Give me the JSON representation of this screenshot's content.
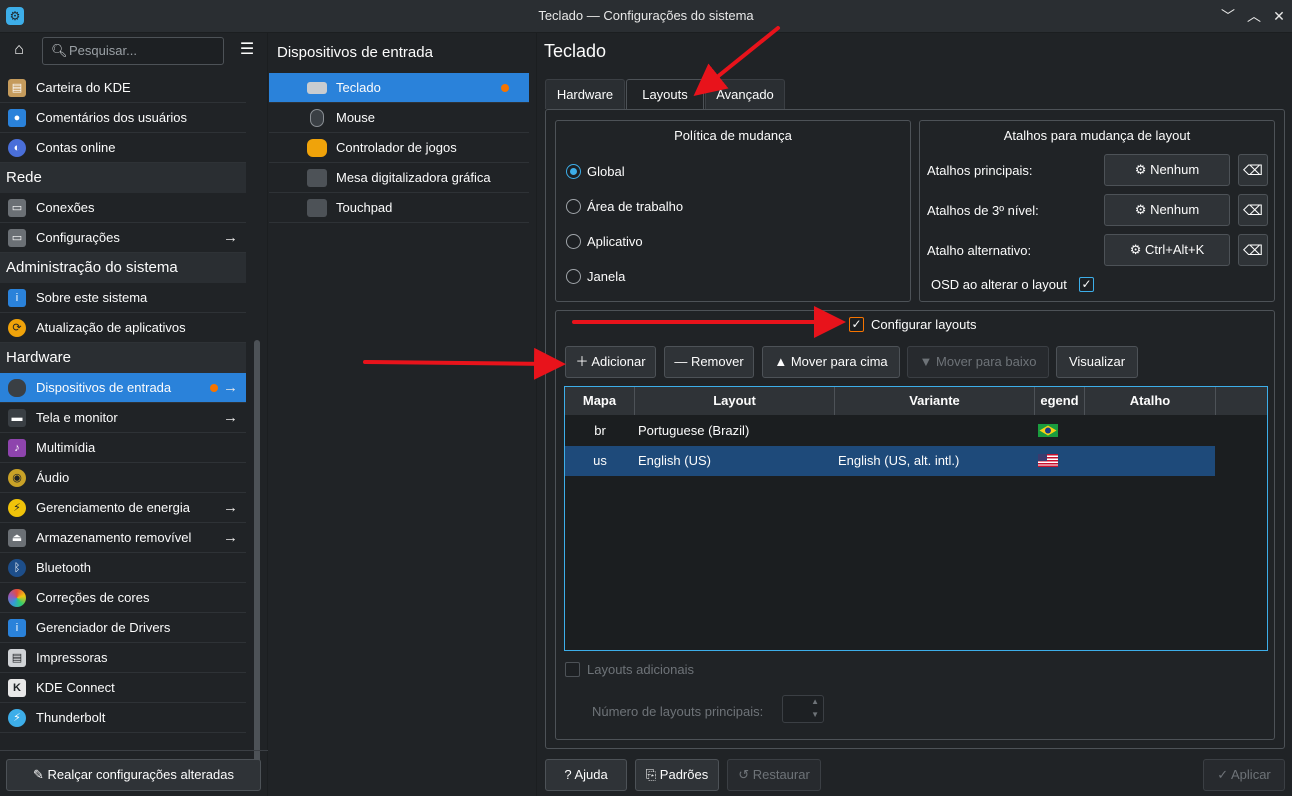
{
  "window": {
    "title": "Teclado — Configurações do sistema"
  },
  "sidebar": {
    "search_placeholder": "Pesquisar...",
    "items_top": [
      {
        "label": "Carteira do KDE",
        "icon": "wallet-icon"
      },
      {
        "label": "Comentários dos usuários",
        "icon": "feedback-icon"
      },
      {
        "label": "Contas online",
        "icon": "online-accounts-icon"
      }
    ],
    "cat_rede": "Rede",
    "items_rede": [
      {
        "label": "Conexões",
        "icon": "network-icon"
      },
      {
        "label": "Configurações",
        "icon": "network-settings-icon"
      }
    ],
    "cat_admin": "Administração do sistema",
    "items_admin": [
      {
        "label": "Sobre este sistema",
        "icon": "info-icon"
      },
      {
        "label": "Atualização de aplicativos",
        "icon": "update-icon"
      }
    ],
    "cat_hardware": "Hardware",
    "items_hardware": [
      {
        "label": "Dispositivos de entrada",
        "icon": "mouse-icon"
      },
      {
        "label": "Tela e monitor",
        "icon": "display-icon"
      },
      {
        "label": "Multimídia",
        "icon": "multimedia-icon"
      },
      {
        "label": "Áudio",
        "icon": "audio-icon"
      },
      {
        "label": "Gerenciamento de energia",
        "icon": "power-icon"
      },
      {
        "label": "Armazenamento removível",
        "icon": "storage-icon"
      },
      {
        "label": "Bluetooth",
        "icon": "bluetooth-icon"
      },
      {
        "label": "Correções de cores",
        "icon": "color-icon"
      },
      {
        "label": "Gerenciador de Drivers",
        "icon": "drivers-icon"
      },
      {
        "label": "Impressoras",
        "icon": "printer-icon"
      },
      {
        "label": "KDE Connect",
        "icon": "kdeconnect-icon"
      },
      {
        "label": "Thunderbolt",
        "icon": "thunderbolt-icon"
      }
    ],
    "footer": "Realçar configurações alteradas"
  },
  "middle": {
    "title": "Dispositivos de entrada",
    "items": [
      {
        "label": "Teclado"
      },
      {
        "label": "Mouse"
      },
      {
        "label": "Controlador de jogos"
      },
      {
        "label": "Mesa digitalizadora gráfica"
      },
      {
        "label": "Touchpad"
      }
    ]
  },
  "main": {
    "title": "Teclado",
    "tabs": [
      "Hardware",
      "Layouts",
      "Avançado"
    ],
    "policy": {
      "title": "Política de mudança",
      "options": [
        "Global",
        "Área de trabalho",
        "Aplicativo",
        "Janela"
      ]
    },
    "shortcuts": {
      "title": "Atalhos para mudança de layout",
      "main_label": "Atalhos principais:",
      "main_value": "Nenhum",
      "third_label": "Atalhos de 3º nível:",
      "third_value": "Nenhum",
      "alt_label": "Atalho alternativo:",
      "alt_value": "Ctrl+Alt+K",
      "osd_label": "OSD ao alterar o layout"
    },
    "configure_layouts": "Configurar layouts",
    "buttons": {
      "add": "Adicionar",
      "remove": "Remover",
      "up": "Mover para cima",
      "down": "Mover para baixo",
      "preview": "Visualizar"
    },
    "table": {
      "headers": [
        "Mapa",
        "Layout",
        "Variante",
        "egend",
        "Atalho"
      ],
      "rows": [
        {
          "map": "br",
          "layout": "Portuguese (Brazil)",
          "variant": "",
          "flag": "brazil-flag"
        },
        {
          "map": "us",
          "layout": "English (US)",
          "variant": "English (US, alt. intl.)",
          "flag": "us-flag"
        }
      ]
    },
    "extra_layouts": "Layouts adicionais",
    "main_layouts_count_label": "Número de layouts principais:"
  },
  "footer": {
    "help": "Ajuda",
    "defaults": "Padrões",
    "reset": "Restaurar",
    "apply": "Aplicar"
  },
  "colors": {
    "accent": "#3daee9",
    "selection": "#2a82da",
    "annotation_arrow": "#e8131b",
    "changed_dot": "#f67400"
  }
}
